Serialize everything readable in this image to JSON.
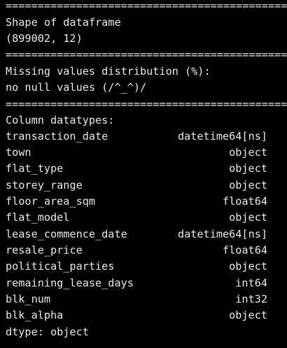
{
  "console": {
    "separator": "================================================",
    "shape_heading": "Shape of dataframe",
    "shape_value": "(899002, 12)",
    "missing_heading": "Missing values distribution (%):",
    "missing_value": "no null values (/^_^)/",
    "dtypes_heading": "Column datatypes:",
    "columns": [
      {
        "name": "transaction_date",
        "dtype": "datetime64[ns]"
      },
      {
        "name": "town",
        "dtype": "object"
      },
      {
        "name": "flat_type",
        "dtype": "object"
      },
      {
        "name": "storey_range",
        "dtype": "object"
      },
      {
        "name": "floor_area_sqm",
        "dtype": "float64"
      },
      {
        "name": "flat_model",
        "dtype": "object"
      },
      {
        "name": "lease_commence_date",
        "dtype": "datetime64[ns]"
      },
      {
        "name": "resale_price",
        "dtype": "float64"
      },
      {
        "name": "political_parties",
        "dtype": "object"
      },
      {
        "name": "remaining_lease_days",
        "dtype": "int64"
      },
      {
        "name": "blk_num",
        "dtype": "int32"
      },
      {
        "name": "blk_alpha",
        "dtype": "object"
      }
    ],
    "dtype_footer": "dtype: object"
  }
}
